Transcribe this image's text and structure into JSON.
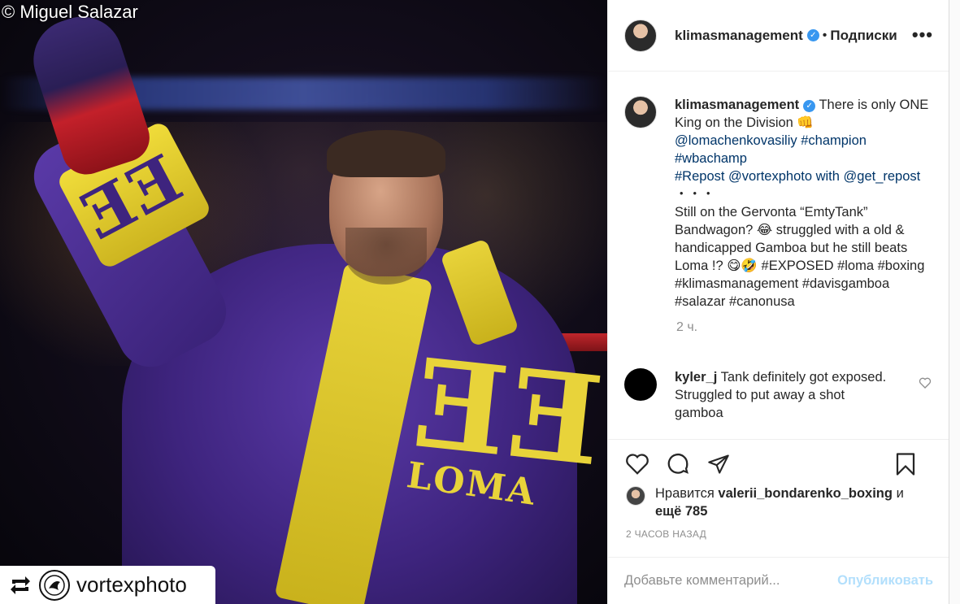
{
  "photo": {
    "copyright": "© Miguel Salazar",
    "robe_text_main": "ƎƎ",
    "robe_text_loma": "LOMA",
    "cuff_text": "ƎƎ",
    "repost_badge": {
      "name": "vortexphoto"
    }
  },
  "header": {
    "username": "klimasmanagement",
    "separator": "•",
    "follow_status": "Подписки",
    "more": "•••"
  },
  "caption": {
    "username": "klimasmanagement",
    "lines": [
      "There is only ONE King on the Division 👊",
      "@lomachenkovasiliy #champion #wbachamp",
      "#Repost @vortexphoto with @get_repost",
      "・・・",
      "Still on the Gervonta “EmtyTank” Bandwagon? 😂 struggled with a old & handicapped Gamboa but he still beats Loma !? 😋🤣 #EXPOSED #loma #boxing #klimasmanagement #davisgamboa #salazar #canonusa"
    ],
    "time": "2 ч."
  },
  "comment": {
    "username": "kyler_j",
    "text": "Tank definitely got exposed. Struggled to put away a shot gamboa"
  },
  "likes": {
    "prefix": "Нравится",
    "user": "valerii_bondarenko_boxing",
    "suffix": "и",
    "more": "ещё 785"
  },
  "post_time": "2 ЧАСОВ НАЗАД",
  "comment_box": {
    "placeholder": "Добавьте комментарий...",
    "publish": "Опубликовать"
  },
  "colors": {
    "link": "#003569",
    "verified": "#3897f0",
    "publish_disabled": "#b2dffc",
    "muted": "#8e8e8e"
  }
}
